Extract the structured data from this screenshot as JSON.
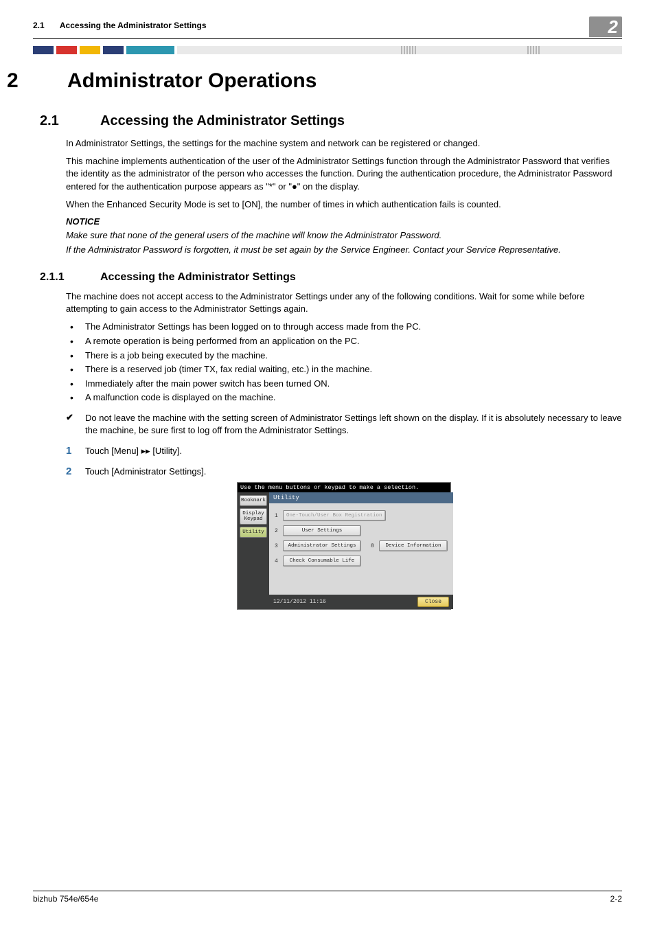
{
  "header": {
    "section_number": "2.1",
    "section_title": "Accessing the Administrator Settings",
    "chapter_tab": "2"
  },
  "chapter": {
    "number": "2",
    "title": "Administrator Operations"
  },
  "section": {
    "number": "2.1",
    "title": "Accessing the Administrator Settings",
    "p1": "In Administrator Settings, the settings for the machine system and network can be registered or changed.",
    "p2": "This machine implements authentication of the user of the Administrator Settings function through the Administrator Password that verifies the identity as the administrator of the person who accesses the function. During the authentication procedure, the Administrator Password entered for the authentication purpose appears as \"*\" or \"●\" on the display.",
    "p3": "When the Enhanced Security Mode is set to [ON], the number of times in which authentication fails is counted.",
    "notice_label": "NOTICE",
    "notice_1": "Make sure that none of the general users of the machine will know the Administrator Password.",
    "notice_2": "If the Administrator Password is forgotten, it must be set again by the Service Engineer. Contact your Service Representative."
  },
  "subsection": {
    "number": "2.1.1",
    "title": "Accessing the Administrator Settings",
    "intro": "The machine does not accept access to the Administrator Settings under any of the following conditions. Wait for some while before attempting to gain access to the Administrator Settings again.",
    "bullets": [
      "The Administrator Settings has been logged on to through access made from the PC.",
      "A remote operation is being performed from an application on the PC.",
      "There is a job being executed by the machine.",
      "There is a reserved job (timer TX, fax redial waiting, etc.) in the machine.",
      "Immediately after the main power switch has been turned ON.",
      "A malfunction code is displayed on the machine."
    ],
    "check": "Do not leave the machine with the setting screen of Administrator Settings left shown on the display. If it is absolutely necessary to leave the machine, be sure first to log off from the Administrator Settings.",
    "step1": "Touch [Menu] ▸▸ [Utility].",
    "step2": "Touch [Administrator Settings]."
  },
  "device": {
    "top_msg": "Use the menu buttons or keypad to make a selection.",
    "left_tabs": {
      "bookmark": "Bookmark",
      "display_keypad": "Display Keypad",
      "utility": "Utility"
    },
    "panel_title": "Utility",
    "menu": {
      "r1_n": "1",
      "r1": "One-Touch/User Box Registration",
      "r2_n": "2",
      "r2": "User Settings",
      "r3_n": "3",
      "r3": "Administrator Settings",
      "r3b_n": "8",
      "r3b": "Device Information",
      "r4_n": "4",
      "r4": "Check Consumable Life"
    },
    "datetime": "12/11/2012   11:16",
    "close": "Close"
  },
  "footer": {
    "left": "bizhub 754e/654e",
    "right": "2-2"
  }
}
